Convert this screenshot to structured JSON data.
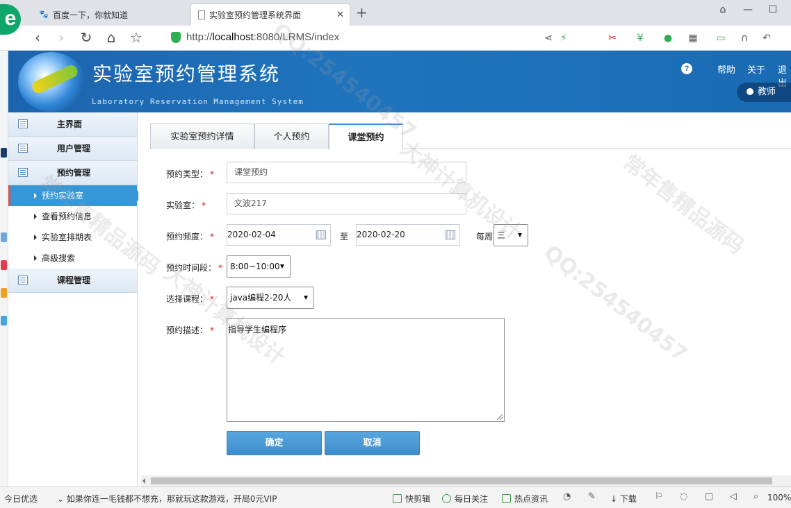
{
  "browser": {
    "tabs": [
      {
        "title": "百度一下，你就知道",
        "icon": "baidu-paw-icon"
      },
      {
        "title": "实验室预约管理系统界面",
        "icon": "page-icon",
        "active": true
      }
    ],
    "url_prefix": "http://",
    "url_host": "localhost",
    "url_rest": ":8080/LRMS/index",
    "new_tab": "+"
  },
  "header": {
    "title": "实验室预约管理系统",
    "subtitle": "Laboratory Reservation Management System",
    "help_glyph": "?",
    "links": [
      "帮助",
      "关于",
      "退出"
    ],
    "role": "教师"
  },
  "sidebar": {
    "groups": [
      {
        "label": "主界面"
      },
      {
        "label": "用户管理"
      },
      {
        "label": "预约管理",
        "items": [
          "预约实验室",
          "查看预约信息",
          "实验室排期表",
          "高级搜索"
        ],
        "active_index": 0
      },
      {
        "label": "课程管理"
      }
    ]
  },
  "tabs": [
    "实验室预约详情",
    "个人预约",
    "课堂预约"
  ],
  "active_tab": 2,
  "form": {
    "required_mark": "*",
    "type_label": "预约类型：",
    "type_value": "课堂预约",
    "lab_label": "实验室：",
    "lab_value": "文波217",
    "freq_label": "预约频度：",
    "start_date": "2020-02-04",
    "to_label": "至",
    "end_date": "2020-02-20",
    "weekly_label": "每周",
    "weekday": "三",
    "time_label": "预约时间段：",
    "time_value": "8:00~10:00",
    "course_label": "选择课程：",
    "course_value": "java编程2-20人",
    "desc_label": "预约描述：",
    "desc_value": "指导学生编程序",
    "confirm": "确定",
    "cancel": "取消"
  },
  "statusbar": {
    "left": "今日优选",
    "ad": "如果你连一毛钱都不想充，那就玩这款游戏，开局0元VIP",
    "items": [
      "快剪辑",
      "每日关注",
      "热点资讯",
      "下载"
    ],
    "zoom": "100%"
  },
  "watermark": {
    "lines": [
      "QQ:254540457",
      "大神计算机设计",
      "常年售精品源码"
    ]
  },
  "colors": {
    "accent": "#3597d6",
    "header": "#1c64ad",
    "required": "#d9131b"
  }
}
